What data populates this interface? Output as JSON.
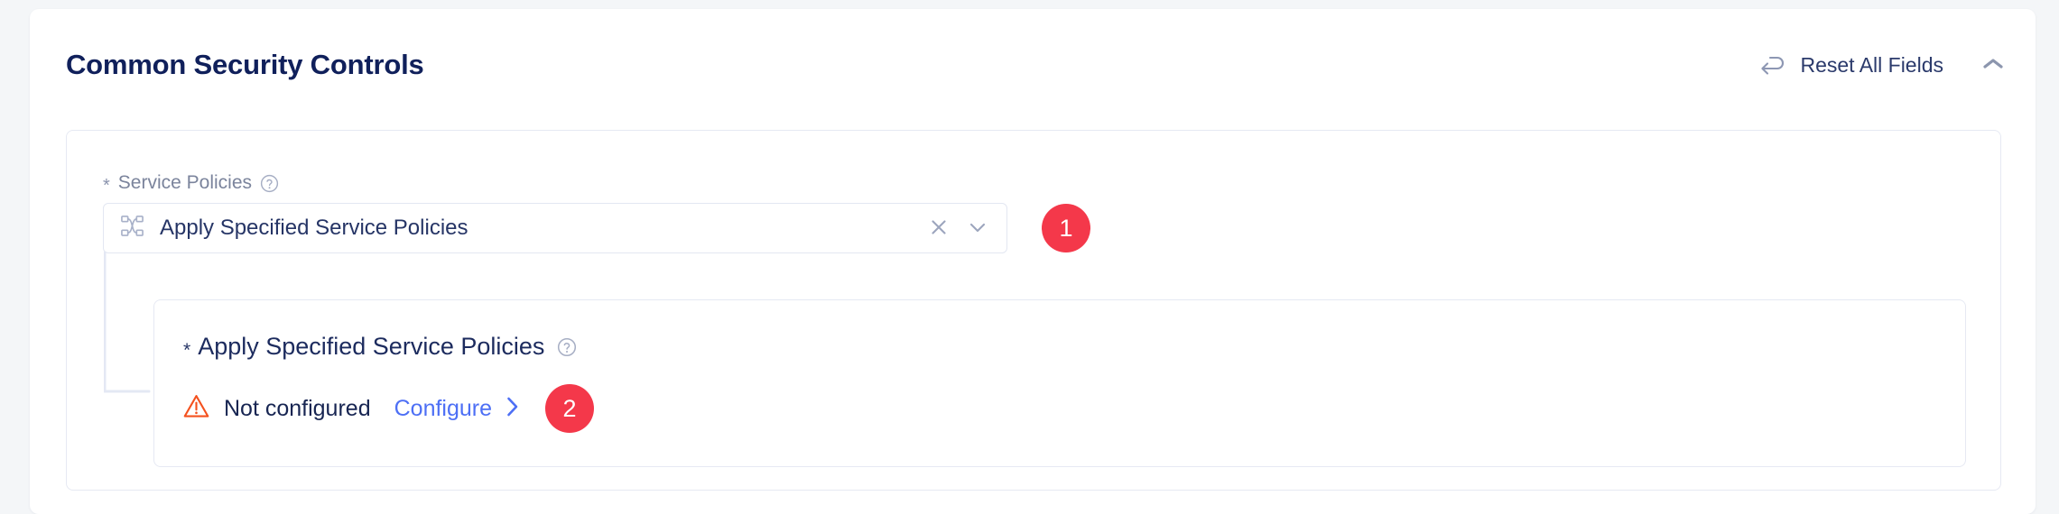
{
  "header": {
    "title": "Common Security Controls",
    "reset_label": "Reset All Fields",
    "reset_icon": "undo-arrow-icon",
    "collapse_icon": "chevron-up-icon"
  },
  "section": {
    "field": {
      "required_marker": "*",
      "label": "Service Policies",
      "help_icon": "question-circle-icon",
      "select": {
        "value": "Apply Specified Service Policies",
        "leading_icon": "network-nodes-icon",
        "clear_icon": "close-icon",
        "expand_icon": "chevron-down-icon"
      },
      "step_badge": "1"
    },
    "sub_card": {
      "required_marker": "*",
      "title": "Apply Specified Service Policies",
      "help_icon": "question-circle-icon",
      "status": {
        "icon": "warning-triangle-icon",
        "text": "Not configured"
      },
      "action": {
        "label": "Configure",
        "icon": "chevron-right-icon"
      },
      "step_badge": "2"
    }
  },
  "colors": {
    "page_background": "#f4f6f8",
    "card_background": "#ffffff",
    "title": "#10205b",
    "label_muted": "#7b849c",
    "border": "#e6e9f3",
    "badge_red": "#f4384a",
    "link_blue": "#4d6ff5",
    "warning_orange": "#f4511e",
    "value_navy": "#263566"
  }
}
